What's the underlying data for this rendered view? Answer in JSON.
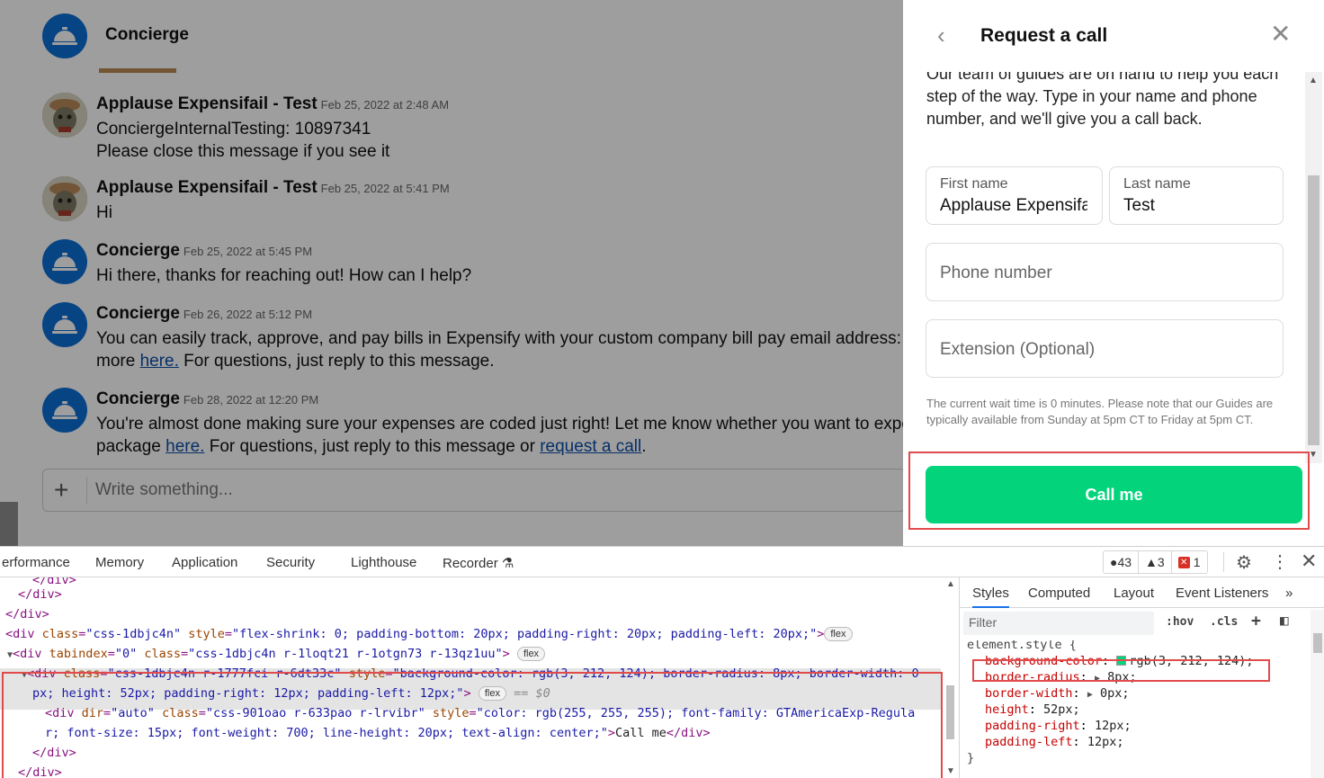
{
  "chat": {
    "header_title": "Concierge",
    "messages": [
      {
        "author": "Applause Expensifail - Test",
        "time": "Feb 25, 2022 at 2:48 AM",
        "lines": [
          "ConciergeInternalTesting: 10897341",
          "Please close this message if you see it"
        ]
      },
      {
        "author": "Applause Expensifail - Test",
        "time": "Feb 25, 2022 at 5:41 PM",
        "lines": [
          "Hi"
        ]
      },
      {
        "author": "Concierge",
        "time": "Feb 25, 2022 at 5:45 PM",
        "lines": [
          "Hi there, thanks for reaching out! How can I help?"
        ]
      },
      {
        "author": "Concierge",
        "time": "Feb 26, 2022 at 5:12 PM",
        "line1": "You can easily track, approve, and pay bills in Expensify with your custom company bill pay email address:",
        "line2_pre": "more ",
        "line2_link": "here.",
        "line2_post": " For questions, just reply to this message."
      },
      {
        "author": "Concierge",
        "time": "Feb 28, 2022 at 12:20 PM",
        "line1": "You're almost done making sure your expenses are coded just right! Let me know whether you want to expo",
        "line2_pre": "package ",
        "line2_link": "here.",
        "line2_mid": " For questions, just reply to this message or ",
        "line2_link2": "request a call",
        "line2_post": "."
      }
    ],
    "composer_placeholder": "Write something...",
    "composer_plus": "+"
  },
  "panel": {
    "back_icon": "‹",
    "title": "Request a call",
    "close_icon": "✕",
    "intro": "Our team of guides are on hand to help you each step of the way. Type in your name and phone number, and we'll give you a call back.",
    "first_name_label": "First name",
    "first_name_value": "Applause Expensifail",
    "last_name_label": "Last name",
    "last_name_value": "Test",
    "phone_placeholder": "Phone number",
    "extension_placeholder": "Extension (Optional)",
    "wait_note": "The current wait time is 0 minutes.  Please note that our Guides are typically available from Sunday at 5pm CT to Friday at 5pm CT.",
    "call_button": "Call me",
    "accent_color": "#03d47c"
  },
  "devtools": {
    "tabs": [
      "erformance",
      "Memory",
      "Application",
      "Security",
      "Lighthouse",
      "Recorder"
    ],
    "counts": {
      "info": "43",
      "warnings": "3",
      "errors": "1"
    },
    "dom": {
      "l0": "</div>",
      "l1": "</div>",
      "l2": "</div>",
      "l3_tag": "<div ",
      "l3_attr1": "class",
      "l3_val1": "\"css-1dbjc4n\"",
      "l3_attr2": "style",
      "l3_val2": "\"flex-shrink: 0; padding-bottom: 20px; padding-right: 20px; padding-left: 20px;\"",
      "l3_end": ">",
      "l4_tag": "<div ",
      "l4_attr1": "tabindex",
      "l4_val1": "\"0\"",
      "l4_attr2": "class",
      "l4_val2": "\"css-1dbjc4n r-1loqt21 r-1otgn73 r-13qz1uu\"",
      "l4_end": ">",
      "l5_tag": "<div ",
      "l5_attr1": "class",
      "l5_val1": "\"css-1dbjc4n r-1777fci r-6dt33c\"",
      "l5_attr2": "style",
      "l5_val2a": "\"background-color: rgb(3, 212, 124); border-radius: 8px; border-width: 0",
      "l5_val2b": "px; height: 52px; padding-right: 12px; padding-left: 12px;\"",
      "l5_end": ">",
      "l5_eq": "== $0",
      "l6_tag": "<div ",
      "l6_attr1": "dir",
      "l6_val1": "\"auto\"",
      "l6_attr2": "class",
      "l6_val2": "\"css-901oao r-633pao r-lrvibr\"",
      "l6_attr3": "style",
      "l6_val3a": "\"color: rgb(255, 255, 255); font-family: GTAmericaExp-Regula",
      "l6_val3b": "r; font-size: 15px; font-weight: 700; line-height: 20px; text-align: center;\"",
      "l6_end": ">",
      "l6_text": "Call me",
      "l6_close": "</div>",
      "l7": "</div>",
      "l8": "</div>",
      "pill": "flex"
    },
    "styles_tabs": [
      "Styles",
      "Computed",
      "Layout",
      "Event Listeners"
    ],
    "filter_placeholder": "Filter",
    "hov": ":hov",
    "cls": ".cls",
    "css": {
      "selector": "element.style {",
      "props": [
        {
          "name": "background-color",
          "value": "rgb(3, 212, 124);",
          "swatch": "#03d47c"
        },
        {
          "name": "border-radius",
          "value": "8px;",
          "arrow": true
        },
        {
          "name": "border-width",
          "value": "0px;",
          "arrow": true
        },
        {
          "name": "height",
          "value": "52px;"
        },
        {
          "name": "padding-right",
          "value": "12px;"
        },
        {
          "name": "padding-left",
          "value": "12px;"
        }
      ],
      "close": "}"
    }
  }
}
